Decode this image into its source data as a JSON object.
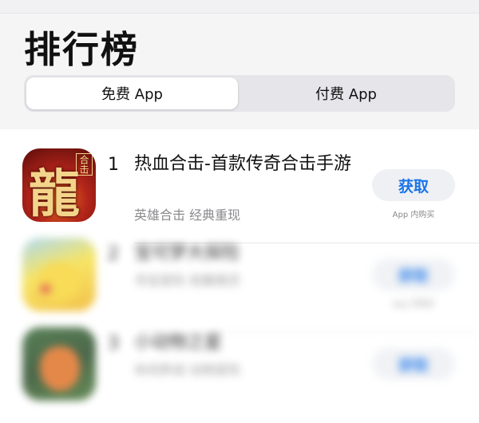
{
  "header": {
    "title": "排行榜"
  },
  "segmented": {
    "free_label": "免费 App",
    "paid_label": "付费 App"
  },
  "apps": [
    {
      "rank": "1",
      "name": "热血合击-首款传奇合击手游",
      "subtitle": "英雄合击 经典重现",
      "button": "获取",
      "note": "App 内购买",
      "icon": "dragon-game-icon",
      "icon_text": "龍",
      "icon_badge": "合击"
    },
    {
      "rank": "2",
      "name": "宝可梦大探险",
      "subtitle": "寻宝冒险 收集精灵",
      "button": "获取",
      "note": "App 内购买",
      "icon": "pikachu-game-icon"
    },
    {
      "rank": "3",
      "name": "小动物之星",
      "subtitle": "休闲养成 动物冒险",
      "button": "获取",
      "note": "App 内购买",
      "icon": "fox-game-icon"
    }
  ]
}
